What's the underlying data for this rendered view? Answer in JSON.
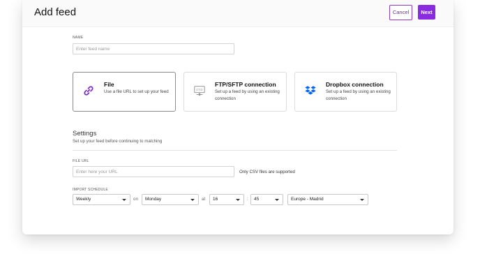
{
  "header": {
    "title": "Add feed",
    "cancel_label": "Cancel",
    "next_label": "Next"
  },
  "name_field": {
    "label": "NAME",
    "placeholder": "Enter feed name"
  },
  "options": [
    {
      "title": "File",
      "description": "Use a file URL to set up your feed",
      "icon": "link-icon",
      "selected": true
    },
    {
      "title": "FTP/SFTP connection",
      "description": "Set up a feed by using an existing connection",
      "icon": "ftp-icon",
      "selected": false
    },
    {
      "title": "Dropbox connection",
      "description": "Set up a feed by using an existing connection",
      "icon": "dropbox-icon",
      "selected": false
    }
  ],
  "settings": {
    "title": "Settings",
    "subtitle": "Set up your feed before continuing to matching"
  },
  "file_url": {
    "label": "FILE URL",
    "placeholder": "Enter here your URL",
    "note": "Only CSV files are supported"
  },
  "schedule": {
    "label": "IMPORT SCHEDULE",
    "frequency": "Weekly",
    "on_label": "on",
    "day": "Monday",
    "at_label": "at",
    "hour": "16",
    "time_sep": ":",
    "minute": "45",
    "timezone": "Europe - Madrid"
  },
  "colors": {
    "accent": "#8a2be2",
    "accent_outline": "#8b3cc6",
    "dropbox_blue": "#0061fe"
  }
}
